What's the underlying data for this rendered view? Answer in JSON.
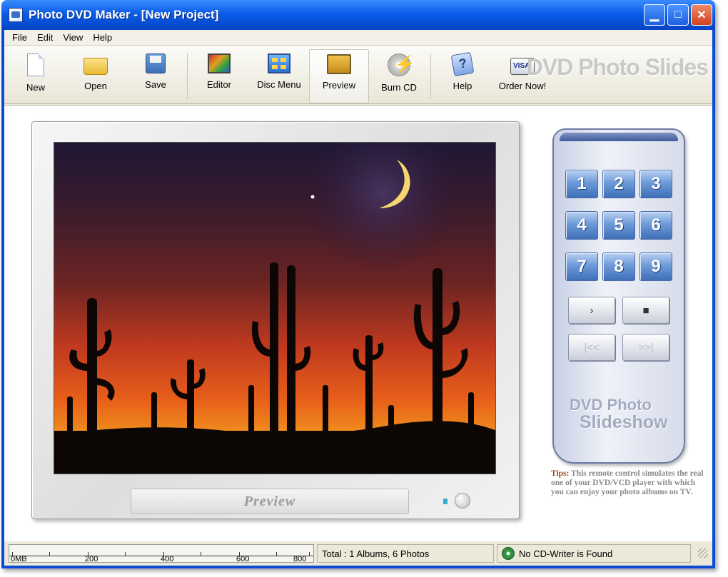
{
  "window": {
    "title": "Photo DVD Maker - [New Project]"
  },
  "menu": [
    "File",
    "Edit",
    "View",
    "Help"
  ],
  "toolbar": {
    "buttons": [
      {
        "label": "New",
        "icon": "new-document-icon"
      },
      {
        "label": "Open",
        "icon": "open-folder-icon"
      },
      {
        "label": "Save",
        "icon": "save-disk-icon"
      },
      {
        "label": "Editor",
        "icon": "editor-icon"
      },
      {
        "label": "Disc Menu",
        "icon": "disc-menu-icon"
      },
      {
        "label": "Preview",
        "icon": "preview-icon"
      },
      {
        "label": "Burn CD",
        "icon": "burn-cd-icon"
      },
      {
        "label": "Help",
        "icon": "help-icon"
      },
      {
        "label": "Order Now!",
        "icon": "visa-card-icon"
      }
    ],
    "active": "Preview",
    "brand_watermark": "DVD Photo Slides"
  },
  "preview": {
    "plate_label": "Preview"
  },
  "remote": {
    "number_keys": [
      "1",
      "2",
      "3",
      "4",
      "5",
      "6",
      "7",
      "8",
      "9"
    ],
    "control_keys": [
      {
        "symbol": "›",
        "icon": "play-icon"
      },
      {
        "symbol": "■",
        "icon": "stop-icon"
      },
      {
        "symbol": "|<<",
        "icon": "previous-icon"
      },
      {
        "symbol": ">>|",
        "icon": "next-icon"
      }
    ],
    "logo_line1": "DVD Photo",
    "logo_line2": "Slideshow"
  },
  "tips": {
    "label": "Tips:",
    "text": "This remote control simulates the real one of your DVD/VCD player with which you can enjoy your photo albums on TV."
  },
  "status": {
    "ruler_labels": [
      "0MB",
      "200",
      "400",
      "600",
      "800"
    ],
    "total": "Total : 1 Albums, 6 Photos",
    "cd_writer": "No CD-Writer is Found"
  },
  "colors": {
    "titlebar": "#0a5ce8",
    "remote_key": "#6e9ad8",
    "tips_label": "#a0461b"
  }
}
